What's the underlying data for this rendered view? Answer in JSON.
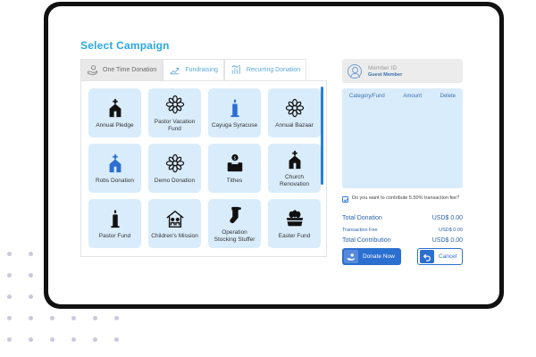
{
  "page": {
    "title": "Select Campaign"
  },
  "tabs": [
    {
      "label": "One Time Donation",
      "icon": "hand-coin-icon"
    },
    {
      "label": "Fundraising",
      "icon": "fundraising-icon"
    },
    {
      "label": "Recurring Donation",
      "icon": "recurring-icon"
    }
  ],
  "campaigns": [
    {
      "label": "Annual Pledge",
      "icon": "church-icon",
      "color": "#111111"
    },
    {
      "label": "Pastor Vacation Fund",
      "icon": "mandala-icon",
      "color": "#111111"
    },
    {
      "label": "Cayuga Syracuse",
      "icon": "candle-icon",
      "color": "#2b6fd1"
    },
    {
      "label": "Annual Bazaar",
      "icon": "mandala-icon",
      "color": "#111111"
    },
    {
      "label": "Robs Donation",
      "icon": "church-icon",
      "color": "#2b6fd1"
    },
    {
      "label": "Demo Donation",
      "icon": "mandala-icon",
      "color": "#111111"
    },
    {
      "label": "Tithes",
      "icon": "donation-box-icon",
      "color": "#111111"
    },
    {
      "label": "Church Renovation",
      "icon": "church-icon",
      "color": "#111111"
    },
    {
      "label": "Pastor Fund",
      "icon": "candle-icon",
      "color": "#111111"
    },
    {
      "label": "Children's Mission",
      "icon": "family-house-icon",
      "color": "#111111"
    },
    {
      "label": "Operation Stocking Stuffer",
      "icon": "stocking-icon",
      "color": "#111111"
    },
    {
      "label": "Easter Fund",
      "icon": "basket-icon",
      "color": "#111111"
    }
  ],
  "member": {
    "label": "Member ID",
    "value": "Guest Member"
  },
  "cart": {
    "columns": [
      "Category/Fund",
      "Amount",
      "Delete"
    ]
  },
  "fee_option": {
    "label": "Do you want to contribute 5.50% transaction fee?",
    "checked": true
  },
  "totals": {
    "donation_label": "Total Donation",
    "donation_value": "USD$ 0.00",
    "fee_label": "Transaction Fee",
    "fee_value": "USD$ 0.00",
    "contribution_label": "Total Contribution",
    "contribution_value": "USD$ 0.00"
  },
  "buttons": {
    "donate": "Donate Now",
    "cancel": "Cancel"
  },
  "colors": {
    "accent": "#2aa7e6",
    "primary": "#2b6fd1",
    "tile_bg": "#d9ecfb"
  }
}
